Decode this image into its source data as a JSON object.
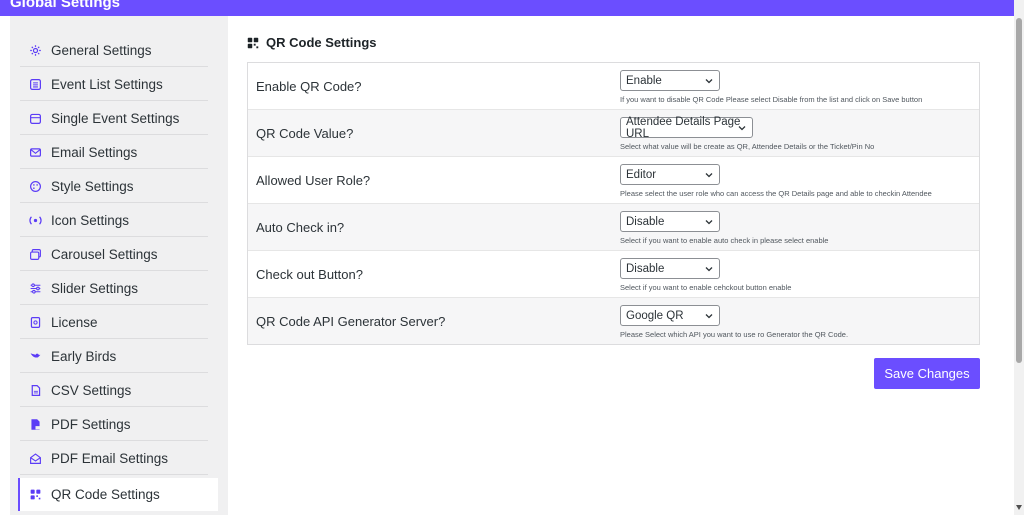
{
  "header": {
    "title": "Global Settings"
  },
  "sidebar": {
    "items": [
      {
        "label": "General Settings",
        "icon": "gear-icon"
      },
      {
        "label": "Event List Settings",
        "icon": "list-icon"
      },
      {
        "label": "Single Event Settings",
        "icon": "calendar-icon"
      },
      {
        "label": "Email Settings",
        "icon": "envelope-icon"
      },
      {
        "label": "Style Settings",
        "icon": "palette-icon"
      },
      {
        "label": "Icon Settings",
        "icon": "target-icon"
      },
      {
        "label": "Carousel Settings",
        "icon": "images-icon"
      },
      {
        "label": "Slider Settings",
        "icon": "sliders-icon"
      },
      {
        "label": "License",
        "icon": "license-icon"
      },
      {
        "label": "Early Birds",
        "icon": "bird-icon"
      },
      {
        "label": "CSV Settings",
        "icon": "file-icon"
      },
      {
        "label": "PDF Settings",
        "icon": "pdf-icon"
      },
      {
        "label": "PDF Email Settings",
        "icon": "envelope-open-icon"
      },
      {
        "label": "QR Code Settings",
        "icon": "qrcode-icon"
      }
    ],
    "active": "QR Code Settings"
  },
  "panel": {
    "title": "QR Code Settings",
    "rows": [
      {
        "label": "Enable QR Code?",
        "value": "Enable",
        "hint": "If you want to disable QR Code Please select Disable from the list and click on Save button"
      },
      {
        "label": "QR Code Value?",
        "value": "Attendee Details Page URL",
        "hint": "Select what value will be create as QR, Attendee Details or the Ticket/Pin No"
      },
      {
        "label": "Allowed User Role?",
        "value": "Editor",
        "hint": "Please select the user role who can access the QR Details page and able to checkin Attendee"
      },
      {
        "label": "Auto Check in?",
        "value": "Disable",
        "hint": "Select if you want to enable auto check in please select enable"
      },
      {
        "label": "Check out Button?",
        "value": "Disable",
        "hint": "Select if you want to enable cehckout button enable"
      },
      {
        "label": "QR Code API Generator Server?",
        "value": "Google QR",
        "hint": "Please Select which API you want to use ro Generator the QR Code."
      }
    ]
  },
  "actions": {
    "save_label": "Save Changes"
  },
  "colors": {
    "accent": "#6b4eff",
    "sidebar_bg": "#f0f0f1"
  }
}
